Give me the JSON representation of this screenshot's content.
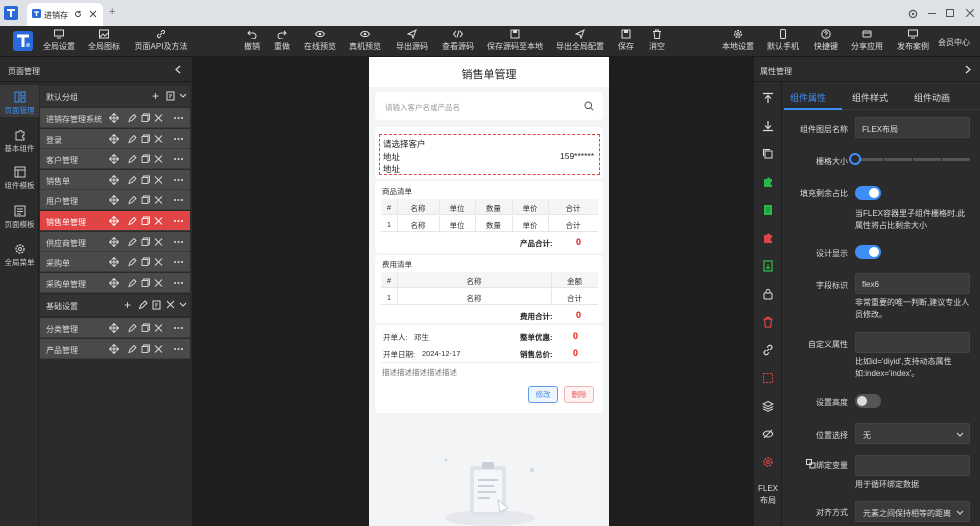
{
  "browser": {
    "tab_title": "进销存",
    "new_tab": "+"
  },
  "toolbar": {
    "global_settings": "全局设置",
    "global_icons": "全局图标",
    "page_api": "页面API及方法",
    "undo": "撤销",
    "redo": "重做",
    "online_preview": "在线预览",
    "device_preview": "真机预览",
    "export_source": "导出源码",
    "view_source": "查看源码",
    "save_source_local": "保存源码至本地",
    "export_global_config": "导出全局配置",
    "save": "保存",
    "clear": "消空",
    "local_settings": "本地设置",
    "default_phone": "默认手机",
    "shortcuts": "快捷键",
    "share_app": "分享应用",
    "publish_case": "发布案例",
    "member_center": "会员中心"
  },
  "rail": {
    "page_manage": "页面管理",
    "basic_components": "基本组件",
    "component_templates": "组件模板",
    "page_templates": "页面模板",
    "global_menu": "全局菜单"
  },
  "left_panel": {
    "title": "页面管理",
    "group1": "默认分组",
    "group1_pages": [
      "进销存管理系统",
      "登录",
      "客户管理",
      "销售单",
      "用户管理",
      "销售单管理",
      "供应商管理",
      "采购单",
      "采购单管理"
    ],
    "selected_index": 5,
    "group2": "基础设置",
    "group2_pages": [
      "分类管理",
      "产品管理"
    ]
  },
  "phone": {
    "title": "销售单管理",
    "search_placeholder": "请输入客户名或产品名",
    "customer": "请选择客户",
    "address1": "地址",
    "phone": "159******",
    "address2": "地址",
    "goods_title": "商品清单",
    "goods_headers": [
      "#",
      "名称",
      "单位",
      "数量",
      "单价",
      "合计"
    ],
    "goods_row": [
      "1",
      "名称",
      "单位",
      "数量",
      "单价",
      "合计"
    ],
    "goods_total_label": "产品合计:",
    "goods_total": "0",
    "fee_title": "费用清单",
    "fee_headers": [
      "#",
      "名称",
      "金额"
    ],
    "fee_row": [
      "1",
      "名称",
      "合计"
    ],
    "fee_total_label": "费用合计:",
    "fee_total": "0",
    "issuer_label": "开单人:",
    "issuer": "邓生",
    "discount_label": "整单优惠:",
    "discount": "0",
    "date_label": "开单日期:",
    "date": "2024-12-17",
    "sale_total_label": "销售总价:",
    "sale_total": "0",
    "description": "描述描述描述描述描述",
    "edit_button": "修改",
    "delete_button": "删除"
  },
  "right_panel": {
    "title": "属性管理",
    "tabs": [
      "组件属性",
      "组件样式",
      "组件动画"
    ],
    "active_tab": 0,
    "layer_name_label": "组件图层名称",
    "layer_name": "FLEX布局",
    "grid_size_label": "栅格大小",
    "fill_label": "填充剩余占比",
    "fill_note": "当FLEX容器里子组件栅格时,此属性将占比剩余大小",
    "design_show_label": "设计显示",
    "field_label": "字段标识",
    "field_value": "flex6",
    "field_note": "非常重要的唯一判断,建议专业人员修改。",
    "custom_attr_label": "自定义属性",
    "custom_attr_note": "比如id='diyid',支持动态属性如:index='index'。",
    "set_height_label": "设置高度",
    "position_label": "位置选择",
    "position_value": "无",
    "bind_var_label": "绑定变量",
    "bind_var_note": "用于循环绑定数据",
    "align_label": "对齐方式",
    "align_value": "元素之间保持相等的距离",
    "flex_label_1": "FLEX",
    "flex_label_2": "布局"
  },
  "colors": {
    "accent": "#3e8ef7",
    "danger": "#e04444",
    "panel": "#2b2b2b"
  }
}
